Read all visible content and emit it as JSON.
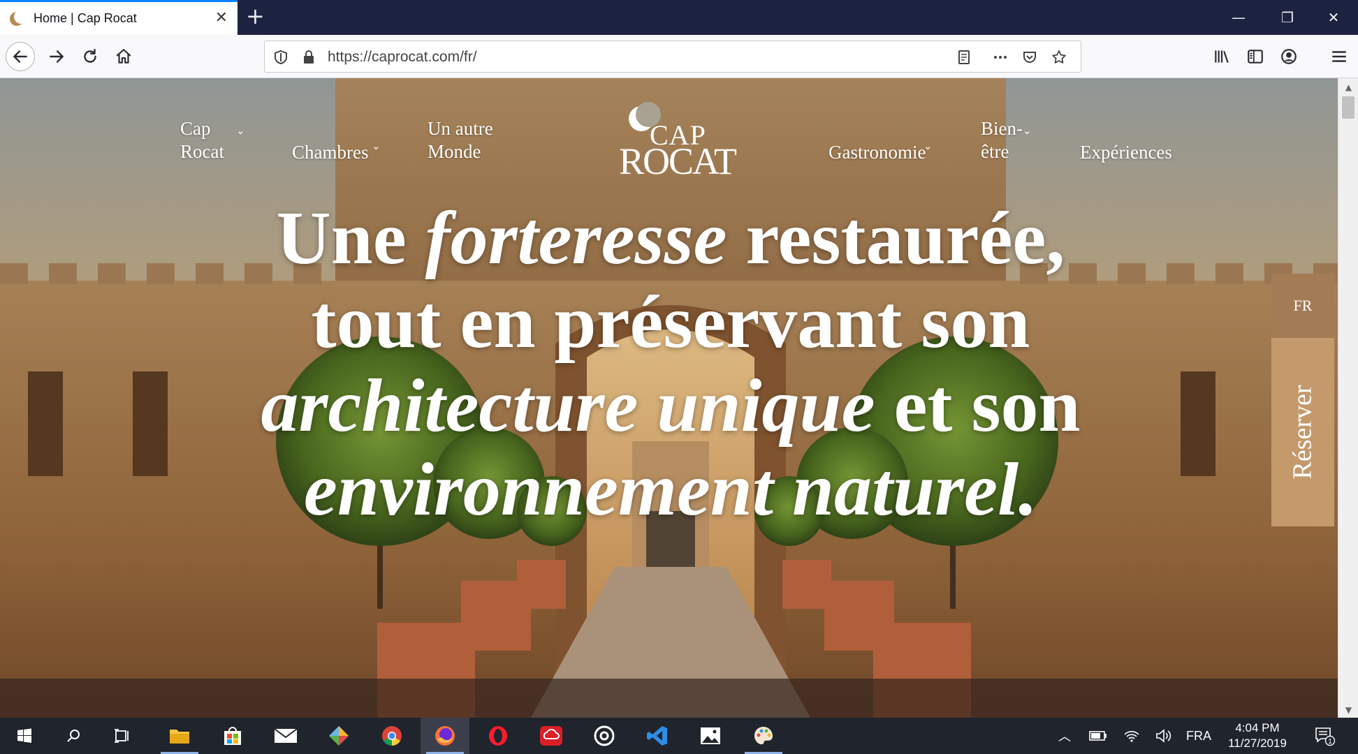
{
  "browser": {
    "tab_title": "Home | Cap Rocat",
    "new_tab_symbol": "+",
    "url": "https://caprocat.com/fr/",
    "window_controls": [
      "minimize-icon",
      "restore-icon",
      "close-icon"
    ]
  },
  "site": {
    "nav_left": [
      {
        "label": "Cap Rocat",
        "has_dropdown": true
      },
      {
        "label": "Chambres",
        "has_dropdown": true
      },
      {
        "label": "Un autre Monde",
        "has_dropdown": false
      }
    ],
    "nav_right": [
      {
        "label": "Gastronomie",
        "has_dropdown": true
      },
      {
        "label": "Bien-être",
        "has_dropdown": true
      },
      {
        "label": "Expériences",
        "has_dropdown": false
      }
    ],
    "logo_line1": "CAP",
    "logo_line2": "ROCAT",
    "headline": {
      "p1": "Une ",
      "p2": "forteresse",
      "p3": " restaurée, tout en préservant son ",
      "p4": "architecture unique",
      "p5": " et son ",
      "p6": "environnement naturel."
    },
    "language": "FR",
    "book_label": "Réserver"
  },
  "taskbar": {
    "apps": [
      "start-icon",
      "search-icon",
      "task-view-icon",
      "file-explorer-icon",
      "store-icon",
      "mail-icon",
      "app-icon",
      "chrome-icon",
      "firefox-icon",
      "opera-icon",
      "creative-cloud-icon",
      "media-icon",
      "vscode-icon",
      "photos-icon",
      "paint-icon"
    ],
    "language": "FRA",
    "time": "4:04 PM",
    "date": "11/27/2019",
    "notification_count": "1"
  },
  "colors": {
    "tabbar": "#1c2340",
    "accent_tab": "#0a84ff",
    "lang_tab": "#a37b55",
    "book_tab": "#c49a6c",
    "taskbar": "#20242c"
  }
}
